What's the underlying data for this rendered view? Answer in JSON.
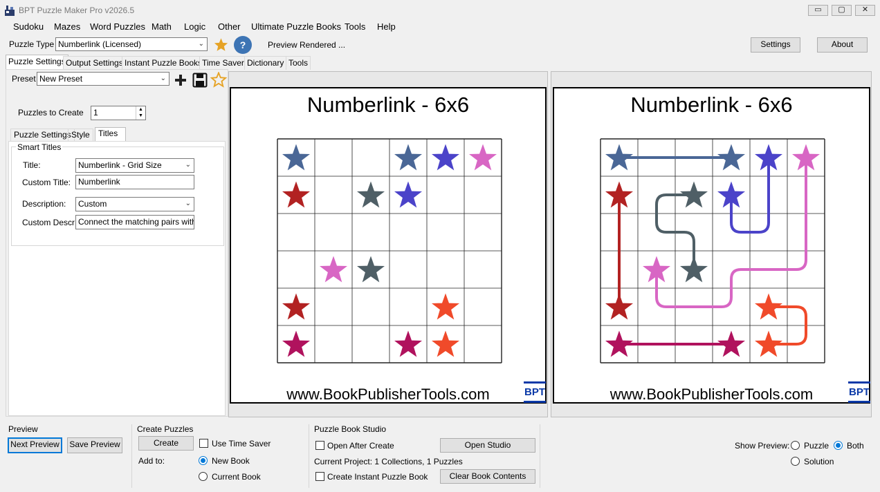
{
  "window": {
    "title": "BPT Puzzle Maker Pro v2026.5",
    "controls": {
      "minimize": "▭",
      "maximize": "▢",
      "close": "✕"
    }
  },
  "menu": [
    "Sudoku",
    "Mazes",
    "Word Puzzles",
    "Math",
    "Logic",
    "Other",
    "Ultimate Puzzle Books",
    "Tools",
    "Help"
  ],
  "toolbar": {
    "puzzle_type_label": "Puzzle Type",
    "puzzle_type_value": "Numberlink (Licensed)",
    "status": "Preview Rendered ...",
    "settings_button": "Settings",
    "about_button": "About",
    "help_glyph": "?"
  },
  "tabs": [
    "Puzzle Settings",
    "Output Settings",
    "Instant Puzzle Books",
    "Time Saver",
    "Dictionary",
    "Tools"
  ],
  "left_panel": {
    "preset_label": "Preset",
    "preset_value": "New Preset",
    "puzzles_to_create_label": "Puzzles to Create",
    "puzzles_to_create_value": "1",
    "subtabs": [
      "Puzzle Settings",
      "Style",
      "Titles"
    ],
    "group_title": "Smart Titles",
    "title_label": "Title:",
    "title_value": "Numberlink - Grid Size",
    "custom_title_label": "Custom Title:",
    "custom_title_value": "Numberlink",
    "description_label": "Description:",
    "description_value": "Custom",
    "custom_descr_label": "Custom Descr:",
    "custom_descr_value": "Connect the matching pairs without"
  },
  "preview": {
    "puzzle_title": "Numberlink - 6x6",
    "solution_title": "Numberlink - 6x6",
    "url": "www.BookPublisherTools.com",
    "logo_text": "BPT",
    "grid_size": 6,
    "stars": [
      {
        "row": 0,
        "col": 0,
        "color": "#4a6796"
      },
      {
        "row": 0,
        "col": 3,
        "color": "#4a6796"
      },
      {
        "row": 0,
        "col": 4,
        "color": "#4b43c9"
      },
      {
        "row": 0,
        "col": 5,
        "color": "#d866c4"
      },
      {
        "row": 1,
        "col": 0,
        "color": "#b22222"
      },
      {
        "row": 1,
        "col": 2,
        "color": "#4f5f66"
      },
      {
        "row": 1,
        "col": 3,
        "color": "#4b43c9"
      },
      {
        "row": 3,
        "col": 1,
        "color": "#d866c4"
      },
      {
        "row": 3,
        "col": 2,
        "color": "#4f5f66"
      },
      {
        "row": 4,
        "col": 0,
        "color": "#b22222"
      },
      {
        "row": 4,
        "col": 4,
        "color": "#f04a2a"
      },
      {
        "row": 5,
        "col": 0,
        "color": "#b0125d"
      },
      {
        "row": 5,
        "col": 3,
        "color": "#b0125d"
      },
      {
        "row": 5,
        "col": 4,
        "color": "#f04a2a"
      }
    ],
    "solution_paths": [
      {
        "color": "#4a6796",
        "cells": [
          [
            0,
            0
          ],
          [
            0,
            3
          ]
        ]
      },
      {
        "color": "#4b43c9",
        "cells": [
          [
            0,
            4
          ],
          [
            2,
            4
          ],
          [
            2,
            3
          ],
          [
            1,
            3
          ]
        ]
      },
      {
        "color": "#d866c4",
        "cells": [
          [
            0,
            5
          ],
          [
            3,
            5
          ],
          [
            3,
            3
          ],
          [
            4,
            3
          ],
          [
            4,
            1
          ],
          [
            3,
            1
          ]
        ]
      },
      {
        "color": "#b22222",
        "cells": [
          [
            1,
            0
          ],
          [
            4,
            0
          ]
        ]
      },
      {
        "color": "#4f5f66",
        "cells": [
          [
            1,
            2
          ],
          [
            1,
            1
          ],
          [
            2,
            1
          ],
          [
            2,
            2
          ],
          [
            3,
            2
          ]
        ]
      },
      {
        "color": "#f04a2a",
        "cells": [
          [
            4,
            4
          ],
          [
            4,
            5
          ],
          [
            5,
            5
          ],
          [
            5,
            4
          ]
        ]
      },
      {
        "color": "#b0125d",
        "cells": [
          [
            5,
            0
          ],
          [
            5,
            3
          ]
        ]
      }
    ]
  },
  "bottom": {
    "preview_group": "Preview",
    "next_preview": "Next Preview",
    "save_preview": "Save Preview",
    "create_group": "Create Puzzles",
    "create_button": "Create",
    "use_time_saver": "Use Time Saver",
    "add_to_label": "Add to:",
    "new_book": "New Book",
    "current_book": "Current Book",
    "studio_group": "Puzzle Book Studio",
    "open_after_create": "Open After Create",
    "open_studio": "Open Studio",
    "current_project": "Current Project: 1 Collections, 1 Puzzles",
    "create_instant_book": "Create Instant Puzzle Book",
    "clear_book_contents": "Clear Book Contents",
    "show_preview_label": "Show Preview:",
    "opt_puzzle": "Puzzle",
    "opt_both": "Both",
    "opt_solution": "Solution",
    "selected_show": "Both",
    "selected_add_to": "New Book"
  }
}
